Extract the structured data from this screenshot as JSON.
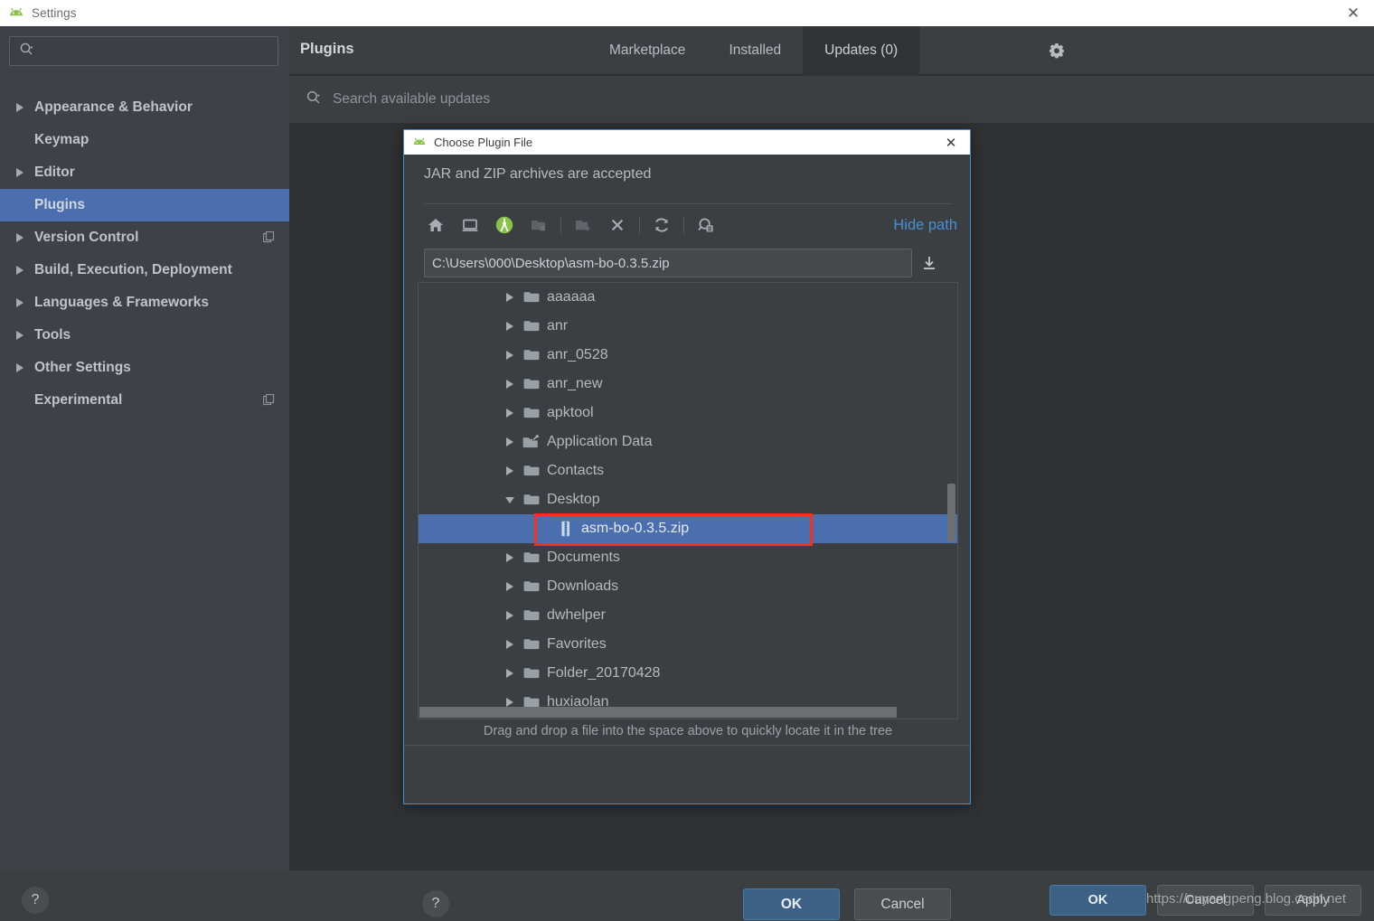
{
  "window": {
    "title": "Settings",
    "icon": "android-studio-icon",
    "close_label": "✕"
  },
  "sidebar": {
    "search": {
      "placeholder": "",
      "value": "",
      "icon": "search-icon"
    },
    "items": [
      {
        "label": "Appearance & Behavior",
        "expandable": true,
        "selected": false,
        "badge": false
      },
      {
        "label": "Keymap",
        "expandable": false,
        "selected": false,
        "badge": false
      },
      {
        "label": "Editor",
        "expandable": true,
        "selected": false,
        "badge": false
      },
      {
        "label": "Plugins",
        "expandable": false,
        "selected": true,
        "badge": false
      },
      {
        "label": "Version Control",
        "expandable": true,
        "selected": false,
        "badge": true
      },
      {
        "label": "Build, Execution, Deployment",
        "expandable": true,
        "selected": false,
        "badge": false
      },
      {
        "label": "Languages & Frameworks",
        "expandable": true,
        "selected": false,
        "badge": false
      },
      {
        "label": "Tools",
        "expandable": true,
        "selected": false,
        "badge": false
      },
      {
        "label": "Other Settings",
        "expandable": true,
        "selected": false,
        "badge": false
      },
      {
        "label": "Experimental",
        "expandable": false,
        "selected": false,
        "badge": true
      }
    ]
  },
  "main": {
    "title": "Plugins",
    "tabs": [
      {
        "label": "Marketplace",
        "active": false
      },
      {
        "label": "Installed",
        "active": false
      },
      {
        "label": "Updates (0)",
        "active": true
      }
    ],
    "gear_icon": "gear-icon",
    "search": {
      "placeholder": "Search available updates",
      "value": "",
      "icon": "search-icon"
    }
  },
  "footer": {
    "help_label": "?",
    "buttons": [
      {
        "label": "OK",
        "primary": true
      },
      {
        "label": "Cancel",
        "primary": false
      },
      {
        "label": "Apply",
        "primary": false
      }
    ],
    "watermark": "https://ouyangpeng.blog.csdn.net"
  },
  "dialog": {
    "title": "Choose Plugin File",
    "icon": "android-studio-icon",
    "close_label": "✕",
    "subtitle": "JAR and ZIP archives are accepted",
    "toolbar": [
      {
        "name": "home-icon",
        "tooltip": "Home",
        "disabled": false
      },
      {
        "name": "desktop-icon",
        "tooltip": "Desktop",
        "disabled": false
      },
      {
        "name": "android-studio-icon",
        "tooltip": "Android Studio",
        "disabled": false
      },
      {
        "name": "project-folder-icon",
        "tooltip": "Project Directory",
        "disabled": true
      },
      {
        "name": "new-folder-icon",
        "tooltip": "New Folder",
        "disabled": true
      },
      {
        "name": "delete-icon",
        "tooltip": "Delete",
        "disabled": false
      },
      {
        "name": "refresh-icon",
        "tooltip": "Refresh",
        "disabled": false
      },
      {
        "name": "show-hidden-files-icon",
        "tooltip": "Show Hidden Files",
        "disabled": false
      }
    ],
    "hide_path_label": "Hide path",
    "path": {
      "value": "C:\\Users\\000\\Desktop\\asm-bo-0.3.5.zip",
      "placeholder": "",
      "download_icon": "download-icon"
    },
    "tree": [
      {
        "label": "aaaaaa",
        "type": "folder",
        "depth": 1,
        "state": "collapsed",
        "selected": false
      },
      {
        "label": "anr",
        "type": "folder",
        "depth": 1,
        "state": "collapsed",
        "selected": false
      },
      {
        "label": "anr_0528",
        "type": "folder",
        "depth": 1,
        "state": "collapsed",
        "selected": false
      },
      {
        "label": "anr_new",
        "type": "folder",
        "depth": 1,
        "state": "collapsed",
        "selected": false
      },
      {
        "label": "apktool",
        "type": "folder",
        "depth": 1,
        "state": "collapsed",
        "selected": false
      },
      {
        "label": "Application Data",
        "type": "symlink",
        "depth": 1,
        "state": "collapsed",
        "selected": false
      },
      {
        "label": "Contacts",
        "type": "folder",
        "depth": 1,
        "state": "collapsed",
        "selected": false
      },
      {
        "label": "Desktop",
        "type": "folder",
        "depth": 1,
        "state": "expanded",
        "selected": false
      },
      {
        "label": "asm-bo-0.3.5.zip",
        "type": "zip",
        "depth": 2,
        "state": "leaf",
        "selected": true
      },
      {
        "label": "Documents",
        "type": "folder",
        "depth": 1,
        "state": "collapsed",
        "selected": false
      },
      {
        "label": "Downloads",
        "type": "folder",
        "depth": 1,
        "state": "collapsed",
        "selected": false
      },
      {
        "label": "dwhelper",
        "type": "folder",
        "depth": 1,
        "state": "collapsed",
        "selected": false
      },
      {
        "label": "Favorites",
        "type": "folder",
        "depth": 1,
        "state": "collapsed",
        "selected": false
      },
      {
        "label": "Folder_20170428",
        "type": "folder",
        "depth": 1,
        "state": "collapsed",
        "selected": false
      },
      {
        "label": "huxiaolan",
        "type": "folder",
        "depth": 1,
        "state": "collapsed",
        "selected": false
      }
    ],
    "dnd_hint": "Drag and drop a file into the space above to quickly locate it in the tree",
    "help_label": "?",
    "buttons": [
      {
        "label": "OK",
        "primary": true
      },
      {
        "label": "Cancel",
        "primary": false
      }
    ]
  },
  "colors": {
    "selection_blue": "#4b6eaf",
    "accent_link": "#4a8fd4",
    "annotation_red": "#f92f1c",
    "sidebar_bg": "#3e4247",
    "panel_bg": "#3c3f41",
    "content_bg": "#2f3133",
    "android_green": "#8ac249"
  }
}
